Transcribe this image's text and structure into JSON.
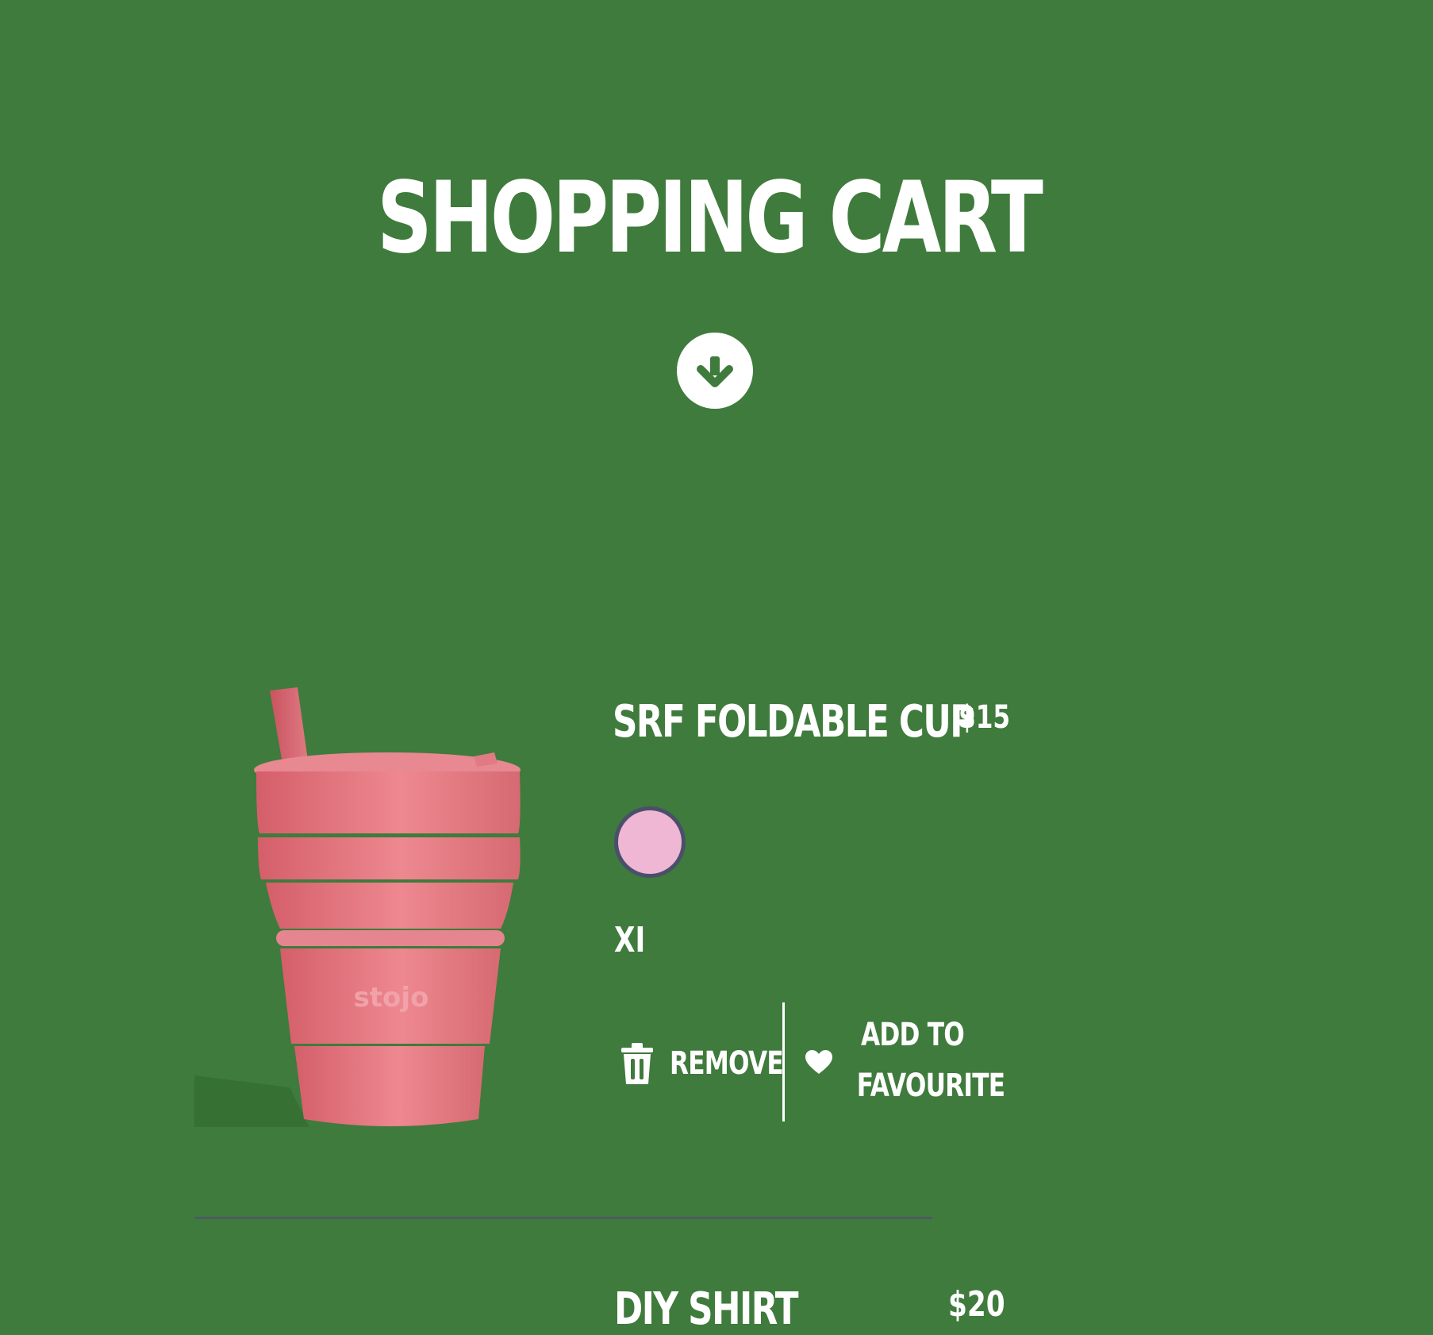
{
  "page": {
    "title": "SHOPPING CART",
    "background_color": "#3f7b3c",
    "scroll_icon": "arrow-down-circle-icon"
  },
  "cart": {
    "items": [
      {
        "name": "SRF FOLDABLE CUP",
        "price": "$15",
        "color_swatch": "#efb7d3",
        "size": "XI",
        "image_brand_text": "stojo",
        "image_icon": "pink-foldable-cup-image",
        "remove_label": "REMOVE",
        "remove_icon": "trash-icon",
        "favourite_label_line1": "ADD TO",
        "favourite_label_line2": "FAVOURITE",
        "favourite_icon": "heart-icon"
      },
      {
        "name": "DIY SHIRT",
        "price": "$20"
      }
    ]
  }
}
